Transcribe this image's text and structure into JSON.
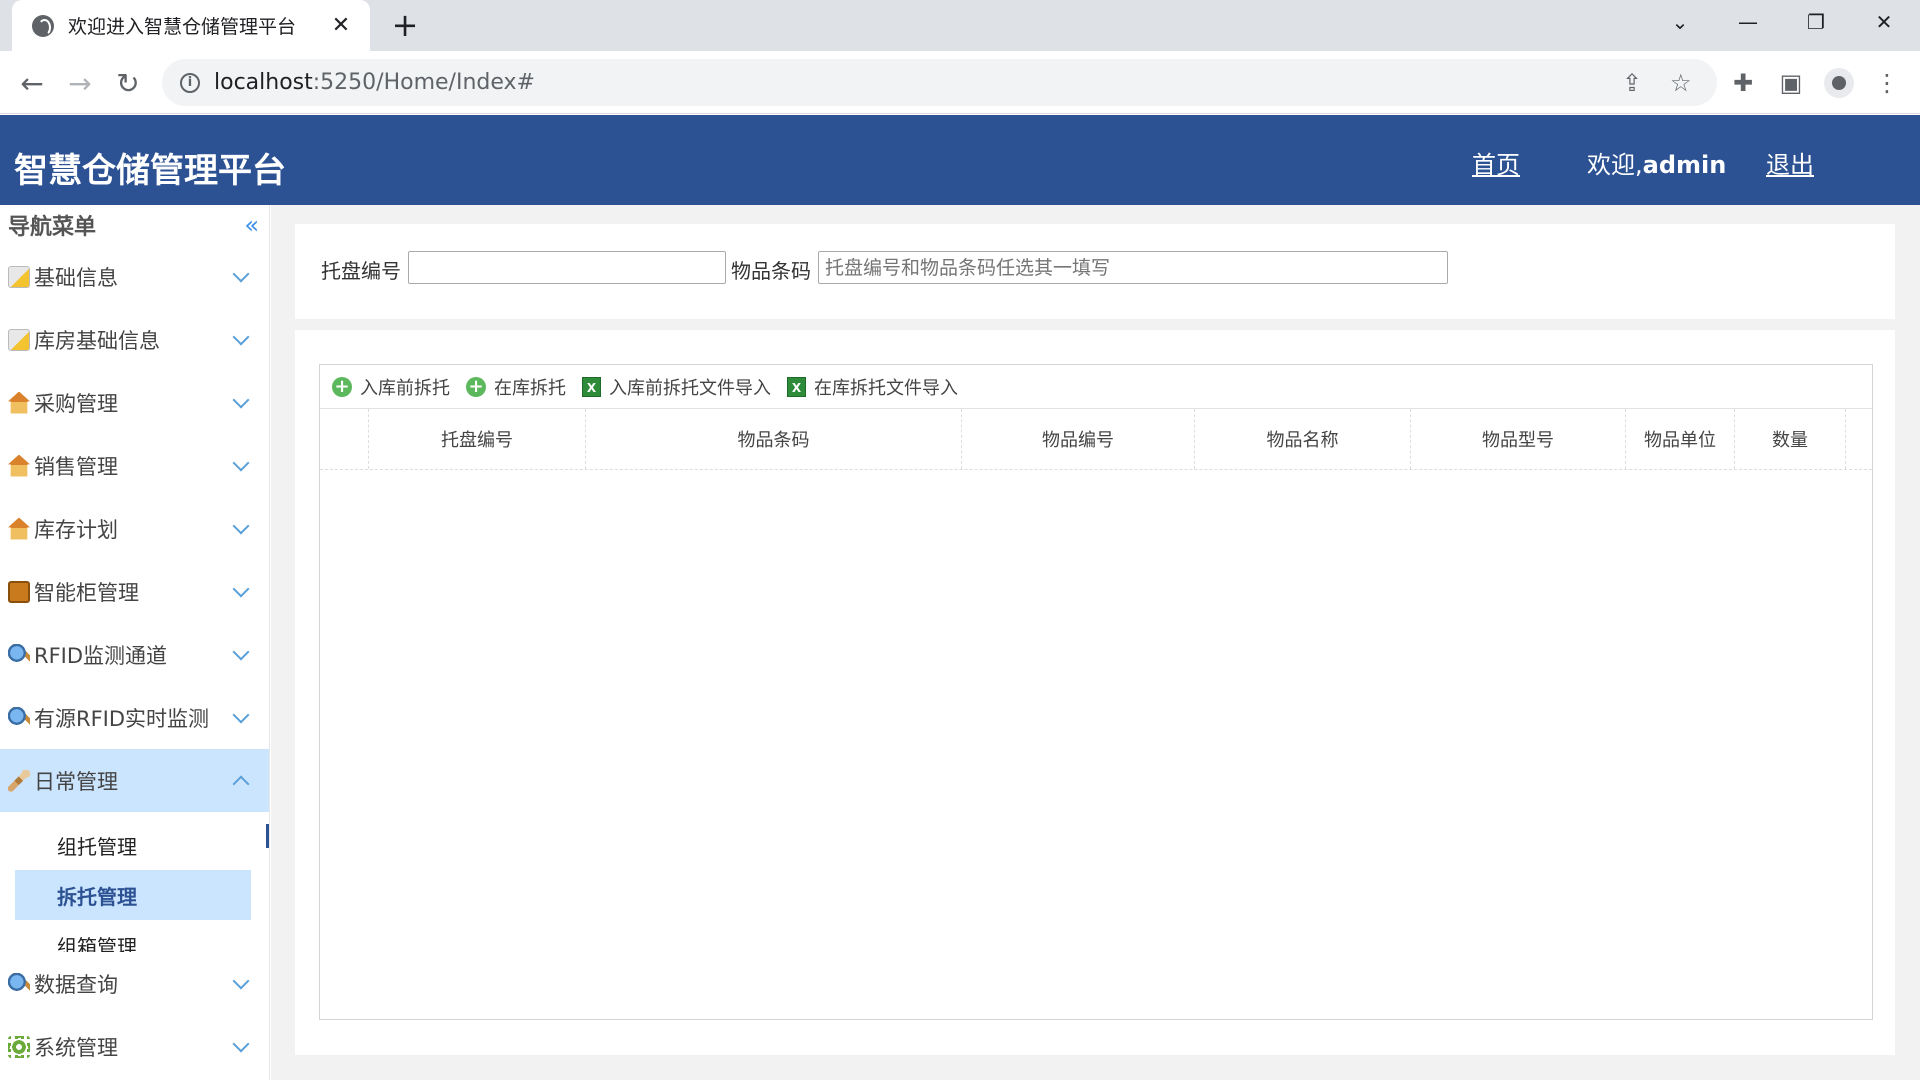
{
  "browser": {
    "tab_title": "欢迎进入智慧仓储管理平台",
    "tab_close": "✕",
    "new_tab": "+",
    "url_host": "localhost",
    "url_rest": ":5250/Home/Index#",
    "window_controls": {
      "chevron": "⌄",
      "minimize": "—",
      "restore": "❐",
      "close": "✕"
    }
  },
  "header": {
    "title": "智慧仓储管理平台",
    "home_link": "首页",
    "welcome_prefix": "欢迎,",
    "welcome_user": "admin",
    "logout_link": "退出"
  },
  "sidebar": {
    "title": "导航菜单",
    "collapse_glyph": "«",
    "items": [
      {
        "label": "基础信息",
        "icon": "document-icon"
      },
      {
        "label": "库房基础信息",
        "icon": "document-icon"
      },
      {
        "label": "采购管理",
        "icon": "house-icon"
      },
      {
        "label": "销售管理",
        "icon": "house-icon"
      },
      {
        "label": "库存计划",
        "icon": "house-icon"
      },
      {
        "label": "智能柜管理",
        "icon": "cabinet-icon"
      },
      {
        "label": "RFID监测通道",
        "icon": "magnifier-icon"
      },
      {
        "label": "有源RFID实时监测",
        "icon": "magnifier-icon"
      },
      {
        "label": "日常管理",
        "icon": "wrench-icon",
        "expanded": true
      },
      {
        "label": "数据查询",
        "icon": "magnifier-icon"
      },
      {
        "label": "系统管理",
        "icon": "gear-icon"
      }
    ],
    "submenu": [
      {
        "label": "组托管理"
      },
      {
        "label": "拆托管理",
        "active": true
      },
      {
        "label": "组箱管理"
      }
    ]
  },
  "search": {
    "pallet_label": "托盘编号",
    "pallet_value": "",
    "barcode_label": "物品条码",
    "barcode_placeholder": "托盘编号和物品条码任选其一填写"
  },
  "grid": {
    "toolbar": [
      {
        "label": "入库前拆托",
        "icon": "add-icon"
      },
      {
        "label": "在库拆托",
        "icon": "add-icon"
      },
      {
        "label": "入库前拆托文件导入",
        "icon": "excel-icon"
      },
      {
        "label": "在库拆托文件导入",
        "icon": "excel-icon"
      }
    ],
    "columns": [
      "托盘编号",
      "物品条码",
      "物品编号",
      "物品名称",
      "物品型号",
      "物品单位",
      "数量"
    ],
    "rows": []
  },
  "colors": {
    "header_bg": "#2c5293",
    "menu_active_bg": "#cce5ff",
    "page_bg": "#f2f2f2"
  }
}
